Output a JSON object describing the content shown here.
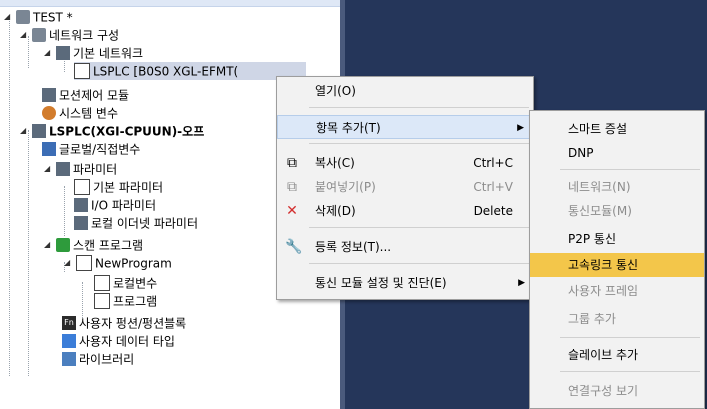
{
  "tree": {
    "project": "TEST *",
    "network_config": "네트워크 구성",
    "basic_network": "기본 네트워크",
    "module_entry": "LSPLC [B0S0 XGL-EFMT(",
    "motion_module": "모션제어 모듈",
    "system_vars": "시스템 변수",
    "plc": "LSPLC(XGI-CPUUN)-오프",
    "global_vars": "글로벌/직접변수",
    "params": "파라미터",
    "basic_params": "기본 파라미터",
    "io_params": "I/O 파라미터",
    "local_eth_params": "로컬 이더넷 파라미터",
    "scan_program": "스캔 프로그램",
    "new_program": "NewProgram",
    "local_vars": "로컬변수",
    "program": "프로그램",
    "user_function": "사용자 펑션/펑션블록",
    "user_datatype": "사용자 데이터 타입",
    "library": "라이브러리"
  },
  "context_menu": {
    "open": "열기(O)",
    "add_item": "항목 추가(T)",
    "copy": "복사(C)",
    "copy_sc": "Ctrl+C",
    "paste": "붙여넣기(P)",
    "paste_sc": "Ctrl+V",
    "delete": "삭제(D)",
    "delete_sc": "Delete",
    "register_info": "등록 정보(T)...",
    "comm_setup": "통신 모듈 설정 및 진단(E)"
  },
  "submenu": {
    "smart_expansion": "스마트 증설",
    "dnp": "DNP",
    "network": "네트워크(N)",
    "comm_module": "통신모듈(M)",
    "p2p": "P2P 통신",
    "highspeed_link": "고속링크 통신",
    "user_frame": "사용자 프레임",
    "add_group": "그룹 추가",
    "add_slave": "슬레이브 추가",
    "view_connection": "연결구성 보기"
  },
  "colors": {
    "highlight": "#f3c64a",
    "panel_dark": "#25365a",
    "selection": "#cfd6e6"
  }
}
